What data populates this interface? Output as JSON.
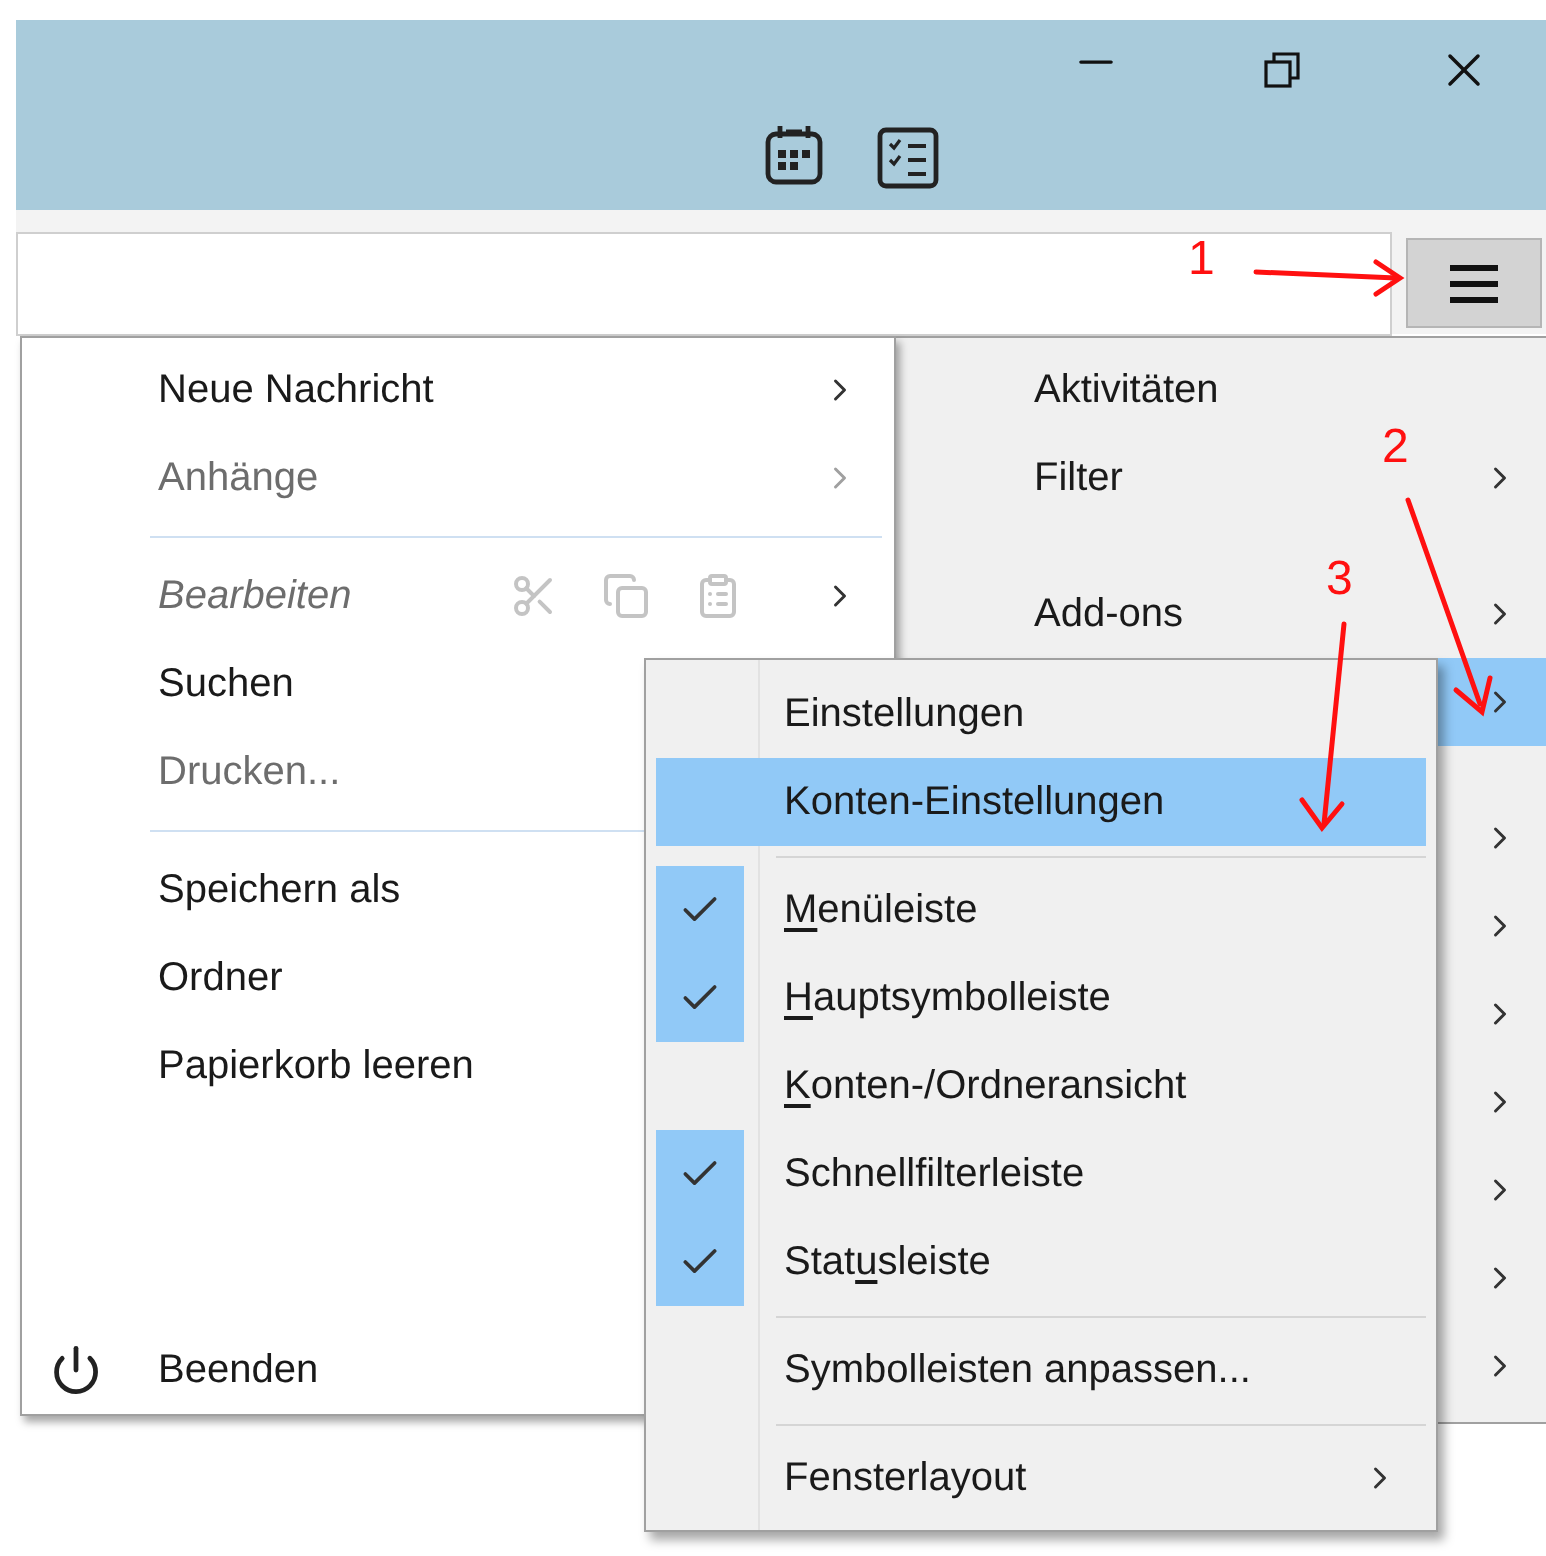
{
  "toolbar": {
    "menu_button": {
      "pressed": true
    }
  },
  "main_menu": {
    "items": [
      {
        "kind": "item",
        "label": "Neue Nachricht",
        "disabled": false,
        "submenu": true
      },
      {
        "kind": "item",
        "label": "Anhänge",
        "disabled": true,
        "submenu": true
      },
      {
        "kind": "separator"
      },
      {
        "kind": "edit",
        "label": "Bearbeiten",
        "disabled": true,
        "submenu": true
      },
      {
        "kind": "item",
        "label": "Suchen",
        "disabled": false
      },
      {
        "kind": "item",
        "label": "Drucken...",
        "disabled": true
      },
      {
        "kind": "separator"
      },
      {
        "kind": "item",
        "label": "Speichern als",
        "disabled": false
      },
      {
        "kind": "item",
        "label": "Ordner",
        "disabled": false
      },
      {
        "kind": "item",
        "label": "Papierkorb leeren",
        "disabled": false
      },
      {
        "kind": "spacer"
      },
      {
        "kind": "quit",
        "label": "Beenden",
        "disabled": false
      }
    ]
  },
  "side_menu": {
    "items": [
      {
        "kind": "item",
        "label": "Aktivitäten",
        "selected": false
      },
      {
        "kind": "item",
        "label": "Filter",
        "submenu": true,
        "selected": false
      },
      {
        "kind": "gap"
      },
      {
        "kind": "item",
        "label": "Add-ons",
        "submenu": true,
        "selected": false
      },
      {
        "kind": "item",
        "submenu": true,
        "selected": true
      },
      {
        "kind": "gap"
      },
      {
        "kind": "item",
        "submenu": true,
        "selected": false
      },
      {
        "kind": "item",
        "submenu": true,
        "selected": false
      },
      {
        "kind": "item",
        "submenu": true,
        "selected": false
      },
      {
        "kind": "item",
        "submenu": true,
        "selected": false
      },
      {
        "kind": "item",
        "submenu": true,
        "selected": false
      },
      {
        "kind": "item",
        "submenu": true,
        "selected": false
      },
      {
        "kind": "item",
        "submenu": true,
        "selected": false
      }
    ]
  },
  "submenu": {
    "items": [
      {
        "kind": "item",
        "label": [
          {
            "text": "Einstellungen",
            "access_key": false
          }
        ],
        "selected": false,
        "submenu": false
      },
      {
        "kind": "item",
        "label": [
          {
            "text": "Konten-Einstellungen",
            "access_key": false
          }
        ],
        "selected": true,
        "submenu": false
      },
      {
        "kind": "separator"
      },
      {
        "kind": "check",
        "label": [
          {
            "text": "M",
            "access_key": true
          },
          {
            "text": "enüleiste",
            "access_key": false
          }
        ],
        "checked": true,
        "selected": false
      },
      {
        "kind": "check",
        "label": [
          {
            "text": "H",
            "access_key": true
          },
          {
            "text": "auptsymbolleiste",
            "access_key": false
          }
        ],
        "checked": true,
        "selected": false
      },
      {
        "kind": "check",
        "label": [
          {
            "text": "K",
            "access_key": true
          },
          {
            "text": "onten-/Ordneransicht",
            "access_key": false
          }
        ],
        "checked": false,
        "selected": false
      },
      {
        "kind": "check",
        "label": [
          {
            "text": "Schnellfilterleiste",
            "access_key": false
          }
        ],
        "checked": true,
        "selected": false
      },
      {
        "kind": "check",
        "label": [
          {
            "text": "Stat",
            "access_key": false
          },
          {
            "text": "u",
            "access_key": true
          },
          {
            "text": "sleiste",
            "access_key": false
          }
        ],
        "checked": true,
        "selected": false
      },
      {
        "kind": "separator"
      },
      {
        "kind": "item",
        "label": [
          {
            "text": "Symbolleisten anpassen...",
            "access_key": false
          }
        ],
        "selected": false,
        "submenu": false
      },
      {
        "kind": "separator"
      },
      {
        "kind": "item",
        "label": [
          {
            "text": "Fensterlayout",
            "access_key": false
          }
        ],
        "selected": false,
        "submenu": true
      }
    ]
  },
  "annotations": [
    {
      "label": "1"
    },
    {
      "label": "2"
    },
    {
      "label": "3"
    }
  ]
}
